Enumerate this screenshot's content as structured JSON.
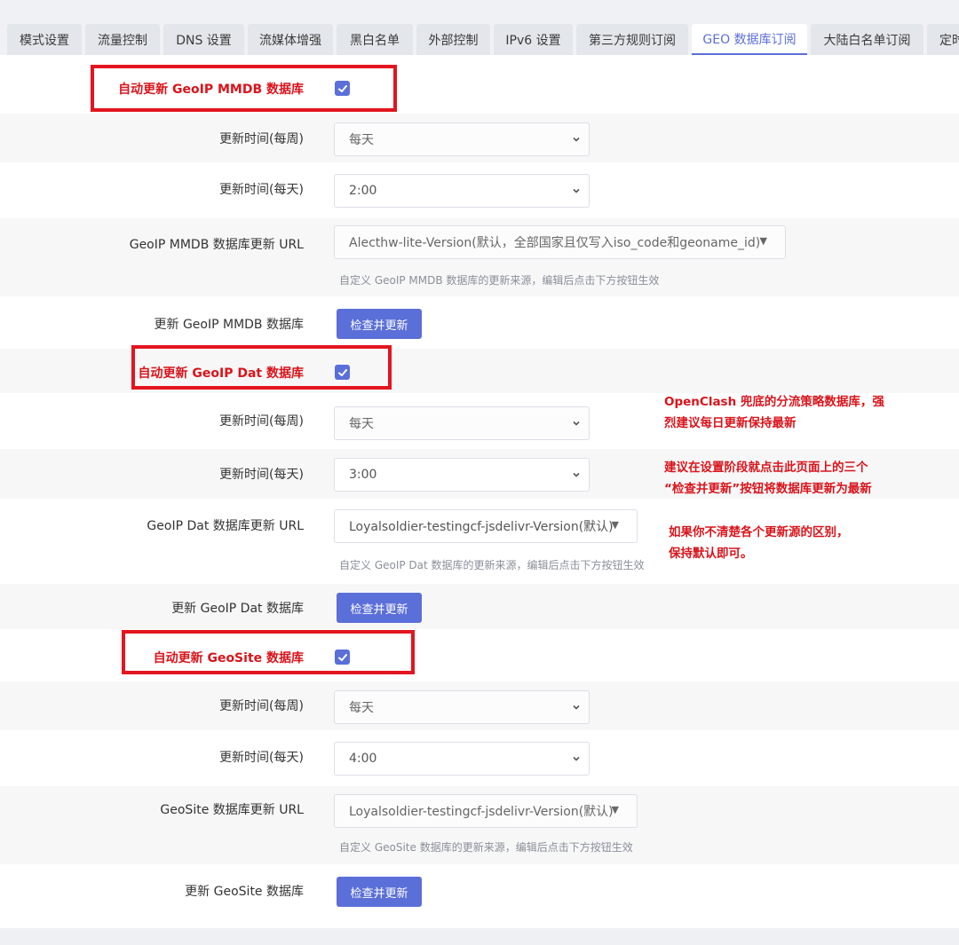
{
  "tabs": [
    {
      "label": "模式设置",
      "active": false
    },
    {
      "label": "流量控制",
      "active": false
    },
    {
      "label": "DNS 设置",
      "active": false
    },
    {
      "label": "流媒体增强",
      "active": false
    },
    {
      "label": "黑白名单",
      "active": false
    },
    {
      "label": "外部控制",
      "active": false
    },
    {
      "label": "IPv6 设置",
      "active": false
    },
    {
      "label": "第三方规则订阅",
      "active": false
    },
    {
      "label": "GEO 数据库订阅",
      "active": true
    },
    {
      "label": "大陆白名单订阅",
      "active": false
    },
    {
      "label": "定时",
      "active": false
    }
  ],
  "mmdb": {
    "auto_label": "自动更新 GeoIP MMDB 数据库",
    "auto_checked": true,
    "week_label": "更新时间(每周)",
    "week_value": "每天",
    "day_label": "更新时间(每天)",
    "day_value": "2:00",
    "url_label": "GeoIP MMDB 数据库更新 URL",
    "url_value": "Alecthw-lite-Version(默认，全部国家且仅写入iso_code和geoname_id)",
    "url_hint": "自定义 GeoIP MMDB 数据库的更新来源，编辑后点击下方按钮生效",
    "update_label": "更新 GeoIP MMDB 数据库",
    "button": "检查并更新"
  },
  "dat": {
    "auto_label": "自动更新 GeoIP Dat 数据库",
    "auto_checked": true,
    "week_label": "更新时间(每周)",
    "week_value": "每天",
    "day_label": "更新时间(每天)",
    "day_value": "3:00",
    "url_label": "GeoIP Dat 数据库更新 URL",
    "url_value": "Loyalsoldier-testingcf-jsdelivr-Version(默认)",
    "url_hint": "自定义 GeoIP Dat 数据库的更新来源，编辑后点击下方按钮生效",
    "update_label": "更新 GeoIP Dat 数据库",
    "button": "检查并更新"
  },
  "geosite": {
    "auto_label": "自动更新 GeoSite 数据库",
    "auto_checked": true,
    "week_label": "更新时间(每周)",
    "week_value": "每天",
    "day_label": "更新时间(每天)",
    "day_value": "4:00",
    "url_label": "GeoSite 数据库更新 URL",
    "url_value": "Loyalsoldier-testingcf-jsdelivr-Version(默认)",
    "url_hint": "自定义 GeoSite 数据库的更新来源，编辑后点击下方按钮生效",
    "update_label": "更新 GeoSite 数据库",
    "button": "检查并更新"
  },
  "notes": {
    "n1_l1": "OpenClash 兜底的分流策略数据库，强",
    "n1_l2": "烈建议每日更新保持最新",
    "n2_l1": "建议在设置阶段就点击此页面上的三个",
    "n2_l2": "“检查并更新”按钮将数据库更新为最新",
    "n3_l1": "如果你不清楚各个更新源的区别，",
    "n3_l2": "保持默认即可。"
  },
  "colors": {
    "accent": "#5b6fd8",
    "annotation_red": "#d9141b"
  }
}
